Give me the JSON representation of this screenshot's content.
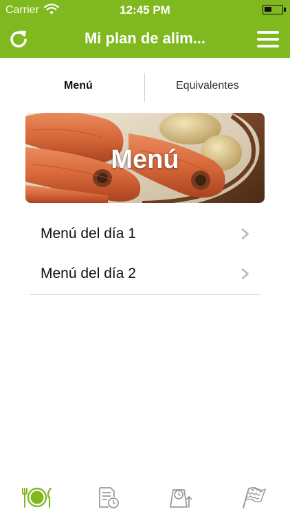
{
  "status_bar": {
    "carrier": "Carrier",
    "time": "12:45 PM"
  },
  "nav": {
    "title": "Mi plan de alim...",
    "refresh_icon": "refresh-icon",
    "menu_icon": "hamburger-menu-icon"
  },
  "tabs": [
    {
      "label": "Menú",
      "active": true
    },
    {
      "label": "Equivalentes",
      "active": false
    }
  ],
  "banner": {
    "label": "Menú",
    "image": "carrots-and-potatoes-photo"
  },
  "list": {
    "items": [
      {
        "label": "Menú del día 1"
      },
      {
        "label": "Menú del día 2"
      }
    ]
  },
  "tab_bar": {
    "items": [
      {
        "icon": "plate-cutlery-icon",
        "active": true
      },
      {
        "icon": "document-clock-icon",
        "active": false
      },
      {
        "icon": "scale-clock-icon",
        "active": false
      },
      {
        "icon": "checkered-flag-icon",
        "active": false
      }
    ]
  },
  "colors": {
    "brand_green": "#7fb81f",
    "inactive_icon": "#9a9a9a"
  }
}
